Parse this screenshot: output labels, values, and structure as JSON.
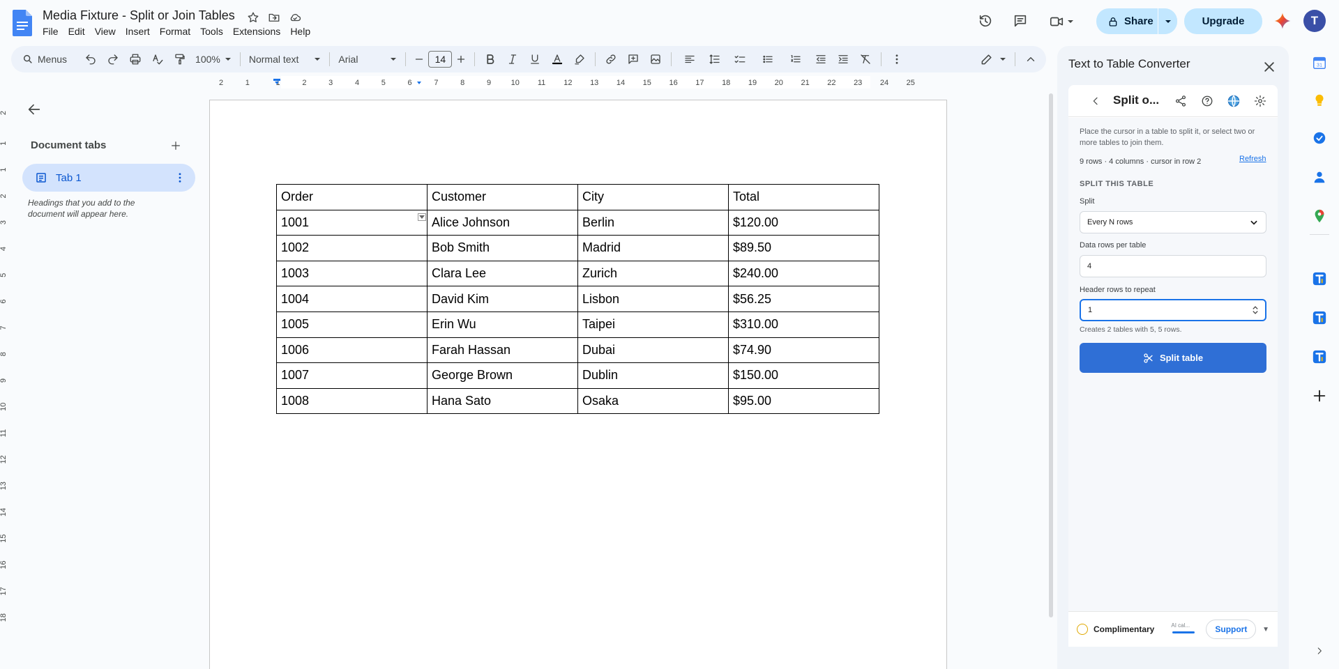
{
  "header": {
    "doc_title": "Media Fixture - Split or Join Tables",
    "menus": [
      "File",
      "Edit",
      "View",
      "Insert",
      "Format",
      "Tools",
      "Extensions",
      "Help"
    ],
    "share_label": "Share",
    "upgrade_label": "Upgrade",
    "avatar_initial": "T"
  },
  "toolbar": {
    "menus_search": "Menus",
    "zoom": "100%",
    "style": "Normal text",
    "font": "Arial",
    "font_size": "14"
  },
  "ruler": {
    "h_labels": [
      "2",
      "1",
      "1",
      "2",
      "3",
      "4",
      "5",
      "6",
      "7",
      "8",
      "9",
      "10",
      "11",
      "12",
      "13",
      "14",
      "15",
      "16",
      "17",
      "18",
      "19",
      "20",
      "21",
      "22",
      "23",
      "24",
      "25"
    ],
    "v_labels": [
      "2",
      "1",
      "1",
      "2",
      "3",
      "4",
      "5",
      "6",
      "7",
      "8",
      "9",
      "10",
      "11",
      "12",
      "13",
      "14",
      "15",
      "16",
      "17",
      "18"
    ]
  },
  "left_pane": {
    "title": "Document tabs",
    "tab_label": "Tab 1",
    "outline_hint": "Headings that you add to the document will appear here."
  },
  "table": {
    "rows": [
      [
        "Order",
        "Customer",
        "City",
        "Total"
      ],
      [
        "1001",
        "Alice Johnson",
        "Berlin",
        "$120.00"
      ],
      [
        "1002",
        "Bob Smith",
        "Madrid",
        "$89.50"
      ],
      [
        "1003",
        "Clara Lee",
        "Zurich",
        "$240.00"
      ],
      [
        "1004",
        "David Kim",
        "Lisbon",
        "$56.25"
      ],
      [
        "1005",
        "Erin Wu",
        "Taipei",
        "$310.00"
      ],
      [
        "1006",
        "Farah Hassan",
        "Dubai",
        "$74.90"
      ],
      [
        "1007",
        "George Brown",
        "Dublin",
        "$150.00"
      ],
      [
        "1008",
        "Hana Sato",
        "Osaka",
        "$95.00"
      ]
    ]
  },
  "side_panel": {
    "title": "Text to Table Converter",
    "section_name": "Split o...",
    "description": "Place the cursor in a table to split it, or select two or more tables to join them.",
    "info": "9 rows · 4 columns · cursor in row 2",
    "refresh": "Refresh",
    "section_heading": "SPLIT THIS TABLE",
    "split_label": "Split",
    "split_value": "Every N rows",
    "data_rows_label": "Data rows per table",
    "data_rows_value": "4",
    "header_rows_label": "Header rows to repeat",
    "header_rows_value": "1",
    "helper": "Creates 2 tables with 5, 5 rows.",
    "split_button": "Split table",
    "plan": "Complimentary",
    "ai_credits": "AI cal...",
    "support": "Support"
  },
  "colors": {
    "accent": "#0b57d0",
    "share_bg": "#c2e7ff",
    "split_button": "#2f6fd6",
    "tab_bg": "#d3e3fd"
  }
}
